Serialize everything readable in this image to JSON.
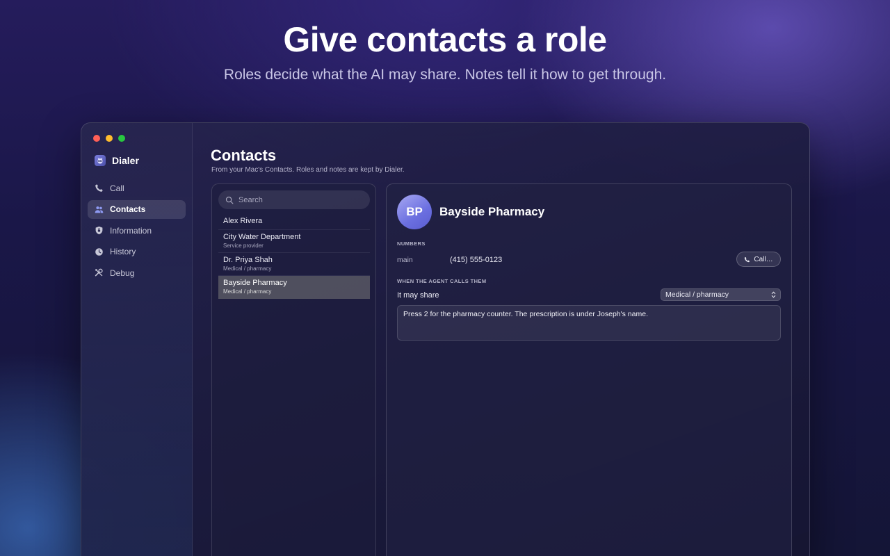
{
  "hero": {
    "title": "Give contacts a role",
    "subtitle": "Roles decide what the AI may share. Notes tell it how to get through."
  },
  "window": {
    "traffic_lights": {
      "close": "#ff5f57",
      "minimize": "#febc2e",
      "zoom": "#28c840"
    }
  },
  "sidebar": {
    "app_name": "Dialer",
    "app_icon": "raccoon-logo-icon",
    "items": [
      {
        "label": "Call",
        "icon": "phone-icon",
        "active": false
      },
      {
        "label": "Contacts",
        "icon": "people-icon",
        "active": true
      },
      {
        "label": "Information",
        "icon": "shield-icon",
        "active": false
      },
      {
        "label": "History",
        "icon": "clock-icon",
        "active": false
      },
      {
        "label": "Debug",
        "icon": "tools-icon",
        "active": false
      }
    ]
  },
  "main": {
    "title": "Contacts",
    "subtitle": "From your Mac's Contacts. Roles and notes are kept by Dialer."
  },
  "list": {
    "search_placeholder": "Search",
    "contacts": [
      {
        "name": "Alex Rivera",
        "role": ""
      },
      {
        "name": "City Water Department",
        "role": "Service provider"
      },
      {
        "name": "Dr. Priya Shah",
        "role": "Medical / pharmacy"
      },
      {
        "name": "Bayside Pharmacy",
        "role": "Medical / pharmacy",
        "selected": true
      }
    ]
  },
  "detail": {
    "initials": "BP",
    "name": "Bayside Pharmacy",
    "numbers_label": "NUMBERS",
    "number_kind": "main",
    "number_value": "(415) 555-0123",
    "call_label": "Call…",
    "agent_section_label": "WHEN THE AGENT CALLS THEM",
    "share_label": "It may share",
    "share_value": "Medical / pharmacy",
    "note": "Press 2 for the pharmacy counter. The prescription is under Joseph's name."
  }
}
